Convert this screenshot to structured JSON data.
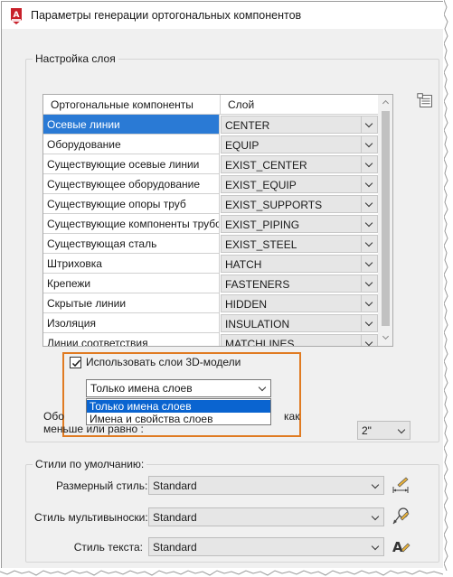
{
  "window": {
    "title": "Параметры генерации ортогональных компонентов"
  },
  "layer_settings": {
    "group_label": "Настройка слоя",
    "columns": [
      "Ортогональные компоненты",
      "Слой"
    ],
    "rows": [
      {
        "component": "Осевые линии",
        "layer": "CENTER",
        "selected": true
      },
      {
        "component": "Оборудование",
        "layer": "EQUIP"
      },
      {
        "component": "Существующие осевые линии",
        "layer": "EXIST_CENTER"
      },
      {
        "component": "Существующее оборудование",
        "layer": "EXIST_EQUIP"
      },
      {
        "component": "Существующие опоры труб",
        "layer": "EXIST_SUPPORTS"
      },
      {
        "component": "Существующие компоненты трубо...",
        "layer": "EXIST_PIPING"
      },
      {
        "component": "Существующая сталь",
        "layer": "EXIST_STEEL"
      },
      {
        "component": "Штриховка",
        "layer": "HATCH"
      },
      {
        "component": "Крепежи",
        "layer": "FASTENERS"
      },
      {
        "component": "Скрытые линии",
        "layer": "HIDDEN"
      },
      {
        "component": "Изоляция",
        "layer": "INSULATION"
      },
      {
        "component": "Линии соответствия",
        "layer": "MATCHLINES"
      }
    ],
    "use_3d_layers": {
      "label": "Использовать слои 3D-модели",
      "checked": true
    },
    "layer_mode": {
      "selected": "Только имена слоев",
      "options": [
        "Только имена слоев",
        "Имена и свойства слоев"
      ],
      "highlighted_option": 0
    },
    "obscured_label_start": "Обо",
    "obscured_label_end": "как",
    "size_label": "меньше или равно :",
    "size_value": "2\""
  },
  "default_styles": {
    "group_label": "Стили по умолчанию:",
    "dimension_style": {
      "label": "Размерный стиль:",
      "value": "Standard"
    },
    "multileader_style": {
      "label": "Стиль мультивыноски:",
      "value": "Standard"
    },
    "text_style": {
      "label": "Стиль текста:",
      "value": "Standard"
    }
  },
  "colors": {
    "highlight_box": "#e07b22",
    "selection": "#2a7ad5",
    "app_icon": "#c8202a"
  }
}
